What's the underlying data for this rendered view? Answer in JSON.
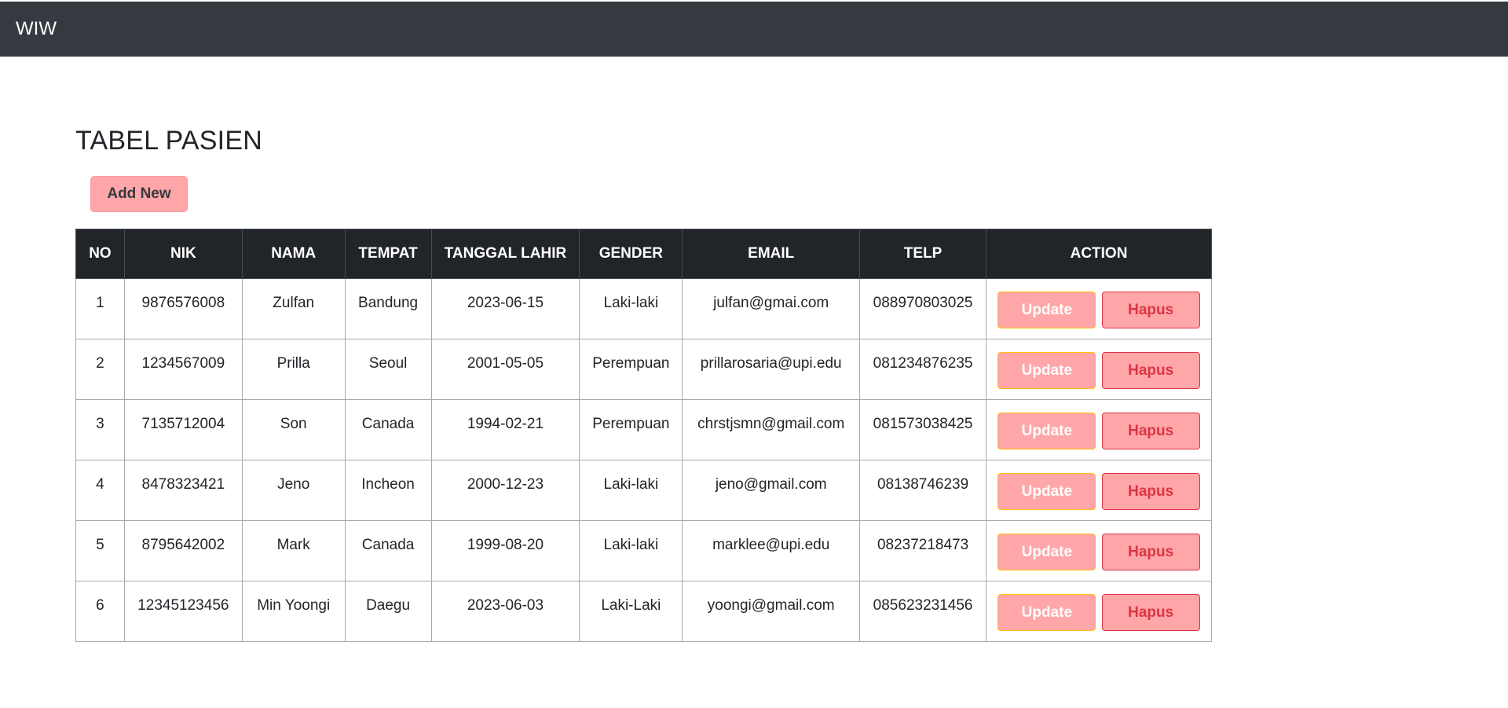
{
  "navbar": {
    "brand": "WIW"
  },
  "page": {
    "title": "TABEL PASIEN",
    "add_button": "Add New"
  },
  "table": {
    "headers": [
      "NO",
      "NIK",
      "NAMA",
      "TEMPAT",
      "TANGGAL LAHIR",
      "GENDER",
      "EMAIL",
      "TELP",
      "ACTION"
    ],
    "update_label": "Update",
    "delete_label": "Hapus",
    "rows": [
      {
        "no": "1",
        "nik": "9876576008",
        "nama": "Zulfan",
        "tempat": "Bandung",
        "tanggal_lahir": "2023-06-15",
        "gender": "Laki-laki",
        "email": "julfan@gmai.com",
        "telp": "088970803025"
      },
      {
        "no": "2",
        "nik": "1234567009",
        "nama": "Prilla",
        "tempat": "Seoul",
        "tanggal_lahir": "2001-05-05",
        "gender": "Perempuan",
        "email": "prillarosaria@upi.edu",
        "telp": "081234876235"
      },
      {
        "no": "3",
        "nik": "7135712004",
        "nama": "Son",
        "tempat": "Canada",
        "tanggal_lahir": "1994-02-21",
        "gender": "Perempuan",
        "email": "chrstjsmn@gmail.com",
        "telp": "081573038425"
      },
      {
        "no": "4",
        "nik": "8478323421",
        "nama": "Jeno",
        "tempat": "Incheon",
        "tanggal_lahir": "2000-12-23",
        "gender": "Laki-laki",
        "email": "jeno@gmail.com",
        "telp": "08138746239"
      },
      {
        "no": "5",
        "nik": "8795642002",
        "nama": "Mark",
        "tempat": "Canada",
        "tanggal_lahir": "1999-08-20",
        "gender": "Laki-laki",
        "email": "marklee@upi.edu",
        "telp": "08237218473"
      },
      {
        "no": "6",
        "nik": "12345123456",
        "nama": "Min Yoongi",
        "tempat": "Daegu",
        "tanggal_lahir": "2023-06-03",
        "gender": "Laki-Laki",
        "email": "yoongi@gmail.com",
        "telp": "085623231456"
      }
    ]
  },
  "colors": {
    "navbar_bg": "#343a40",
    "header_bg": "#212529",
    "button_pink": "#ffa6a8",
    "danger": "#dc3545",
    "warning_border": "#ffc107"
  }
}
